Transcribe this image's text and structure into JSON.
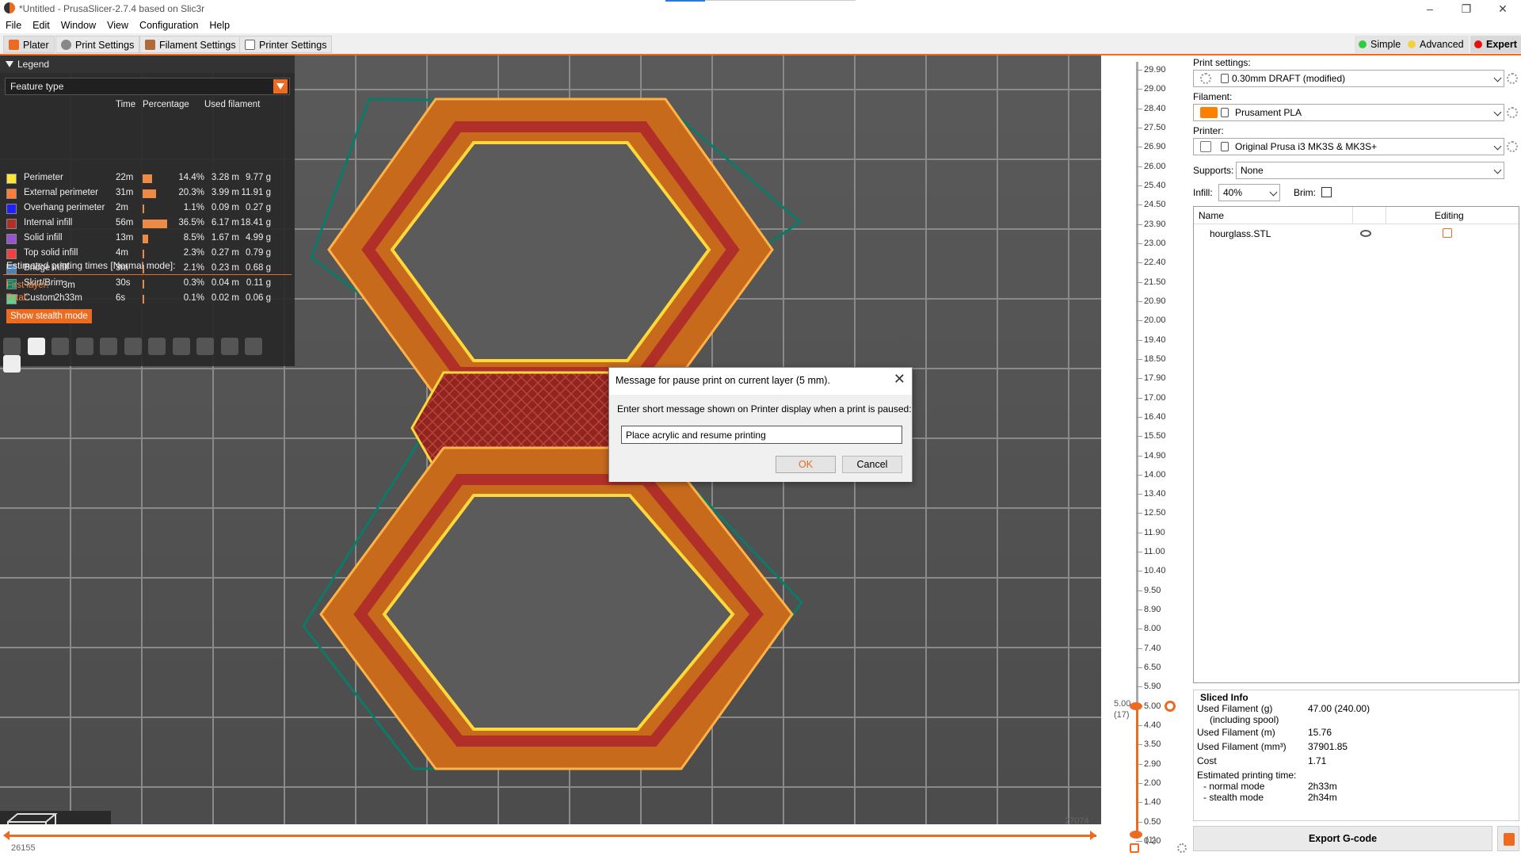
{
  "window": {
    "title": "*Untitled - PrusaSlicer-2.7.4 based on Slic3r"
  },
  "menu": [
    "File",
    "Edit",
    "Window",
    "View",
    "Configuration",
    "Help"
  ],
  "tabs": [
    {
      "label": "Plater",
      "color": "#ed6b21"
    },
    {
      "label": "Print Settings",
      "color": "#888888"
    },
    {
      "label": "Filament Settings",
      "color": "#b06b3b"
    },
    {
      "label": "Printer Settings",
      "color": "#666666"
    }
  ],
  "modes": [
    {
      "label": "Simple",
      "color": "#2ecc40"
    },
    {
      "label": "Advanced",
      "color": "#f4d03f"
    },
    {
      "label": "Expert",
      "color": "#e3120b"
    }
  ],
  "legend": {
    "title": "Legend",
    "selector": "Feature type",
    "headers": {
      "time": "Time",
      "percentage": "Percentage",
      "used": "Used filament"
    },
    "rows": [
      {
        "name": "Perimeter",
        "color": "#ffe53a",
        "time": "22m",
        "pct": "14.4%",
        "pct_value": 14.4,
        "len": "3.28 m",
        "wt": "9.77 g"
      },
      {
        "name": "External perimeter",
        "color": "#ff7d38",
        "time": "31m",
        "pct": "20.3%",
        "pct_value": 20.3,
        "len": "3.99 m",
        "wt": "11.91 g"
      },
      {
        "name": "Overhang perimeter",
        "color": "#1f1fff",
        "time": "2m",
        "pct": "1.1%",
        "pct_value": 1.1,
        "len": "0.09 m",
        "wt": "0.27 g"
      },
      {
        "name": "Internal infill",
        "color": "#b03029",
        "time": "56m",
        "pct": "36.5%",
        "pct_value": 36.5,
        "len": "6.17 m",
        "wt": "18.41 g"
      },
      {
        "name": "Solid infill",
        "color": "#9654cc",
        "time": "13m",
        "pct": "8.5%",
        "pct_value": 8.5,
        "len": "1.67 m",
        "wt": "4.99 g"
      },
      {
        "name": "Top solid infill",
        "color": "#f04040",
        "time": "4m",
        "pct": "2.3%",
        "pct_value": 2.3,
        "len": "0.27 m",
        "wt": "0.79 g"
      },
      {
        "name": "Bridge infill",
        "color": "#4d80ba",
        "time": "3m",
        "pct": "2.1%",
        "pct_value": 2.1,
        "len": "0.23 m",
        "wt": "0.68 g"
      },
      {
        "name": "Skirt/Brim",
        "color": "#00876e",
        "time": "30s",
        "pct": "0.3%",
        "pct_value": 0.3,
        "len": "0.04 m",
        "wt": "0.11 g"
      },
      {
        "name": "Custom",
        "color": "#5ed194",
        "time": "6s",
        "pct": "0.1%",
        "pct_value": 0.1,
        "len": "0.02 m",
        "wt": "0.06 g"
      }
    ],
    "estimated": "Estimated printing times [Normal mode]:",
    "first_layer_label": "First layer:",
    "first_layer": "3m",
    "total_label": "Total:",
    "total": "2h33m",
    "stealth_button": "Show stealth mode"
  },
  "dialog": {
    "title": "Message for pause print on current layer (5 mm).",
    "prompt": "Enter short message shown on Printer display when a print is paused:",
    "value": "Place acrylic and resume printing",
    "ok": "OK",
    "cancel": "Cancel"
  },
  "vertical_slider": {
    "ticks": [
      "29.90",
      "29.00",
      "28.40",
      "27.50",
      "26.90",
      "26.00",
      "25.40",
      "24.50",
      "23.90",
      "23.00",
      "22.40",
      "21.50",
      "20.90",
      "20.00",
      "19.40",
      "18.50",
      "17.90",
      "17.00",
      "16.40",
      "15.50",
      "14.90",
      "14.00",
      "13.40",
      "12.50",
      "11.90",
      "11.00",
      "10.40",
      "9.50",
      "8.90",
      "8.00",
      "7.40",
      "6.50",
      "5.90",
      "5.00",
      "4.40",
      "3.50",
      "2.90",
      "2.00",
      "1.40",
      "0.50",
      "0.20"
    ],
    "current_value": "5.00",
    "current_layer": "(17)",
    "bottom_layer": "(1)"
  },
  "horizontal_slider": {
    "left_value": "26155",
    "right_value": "27074"
  },
  "right_panel": {
    "print_settings_label": "Print settings:",
    "print_settings": "0.30mm DRAFT (modified)",
    "filament_label": "Filament:",
    "filament": "Prusament PLA",
    "filament_color": "#ff8000",
    "printer_label": "Printer:",
    "printer": "Original Prusa i3 MK3S & MK3S+",
    "supports_label": "Supports:",
    "supports": "None",
    "infill_label": "Infill:",
    "infill": "40%",
    "brim_label": "Brim:",
    "brim_checked": false,
    "list_headers": {
      "name": "Name",
      "editing": "Editing"
    },
    "objects": [
      "hourglass.STL"
    ],
    "sliced_info": {
      "title": "Sliced Info",
      "rows": [
        {
          "k": "Used Filament (g)",
          "v": "47.00 (240.00)"
        },
        {
          "k": "(including spool)",
          "v": ""
        },
        {
          "k": "Used Filament (m)",
          "v": "15.76"
        },
        {
          "k": "Used Filament (mm³)",
          "v": "37901.85"
        },
        {
          "k": "Cost",
          "v": "1.71"
        },
        {
          "k": "Estimated printing time:",
          "v": ""
        },
        {
          "k": "- normal mode",
          "v": "2h33m"
        },
        {
          "k": "- stealth mode",
          "v": "2h34m"
        }
      ]
    },
    "export_button": "Export G-code"
  }
}
